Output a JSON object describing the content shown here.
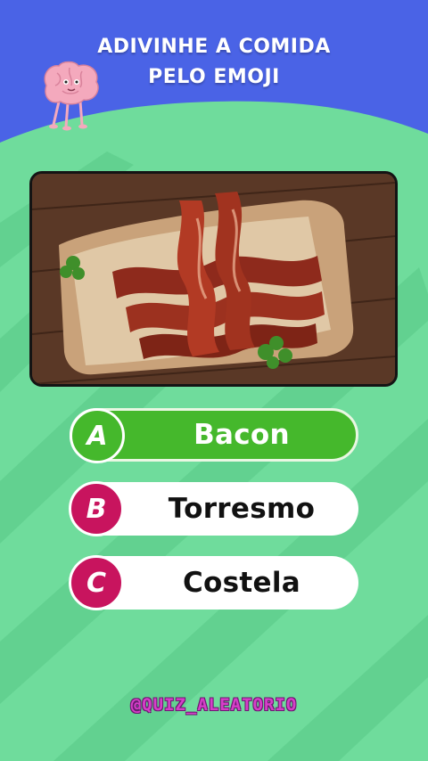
{
  "header": {
    "title_line1": "ADIVINHE A COMIDA",
    "title_line2": "PELO EMOJI",
    "mascot_icon": "brain-icon"
  },
  "question": {
    "image_icon": "bacon-photo"
  },
  "options": [
    {
      "letter": "A",
      "label": "Bacon",
      "state": "correct"
    },
    {
      "letter": "B",
      "label": "Torresmo",
      "state": "default"
    },
    {
      "letter": "C",
      "label": "Costela",
      "state": "default"
    }
  ],
  "footer": {
    "handle": "@QUIZ_ALEATORIO"
  },
  "colors": {
    "sky": "#4a63e6",
    "field_light": "#6fdc9c",
    "field_dark": "#5fcf8e",
    "correct": "#45b82c",
    "badge": "#c8145e",
    "handle": "#d63fc8"
  }
}
